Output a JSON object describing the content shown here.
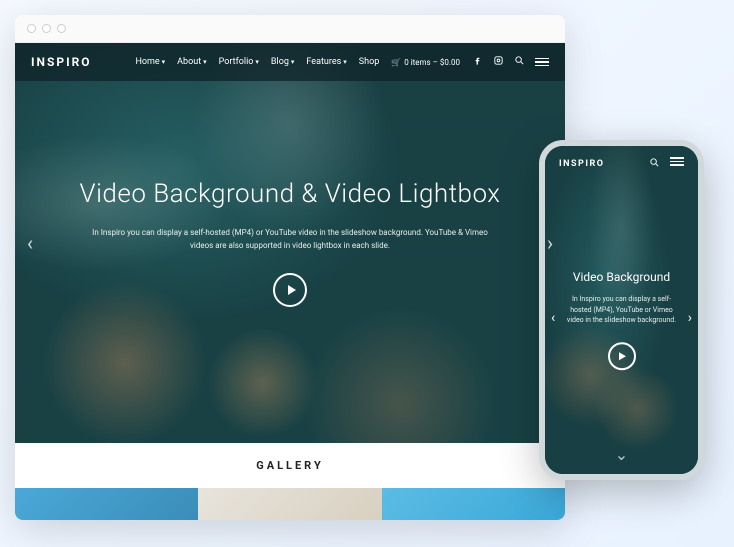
{
  "desktop": {
    "logo": "INSPIRO",
    "nav": {
      "home": "Home",
      "about": "About",
      "portfolio": "Portfolio",
      "blog": "Blog",
      "features": "Features",
      "shop": "Shop",
      "cart": "0 items – $0.00"
    },
    "hero": {
      "title": "Video Background & Video Lightbox",
      "subtitle": "In Inspiro you can display a self-hosted (MP4) or YouTube video in the slideshow background. YouTube & Vimeo videos are also supported in video lightbox in each slide."
    },
    "gallery_label": "GALLERY"
  },
  "mobile": {
    "logo": "INSPIRO",
    "hero": {
      "title": "Video Background",
      "subtitle": "In Inspiro you can display a self-hosted (MP4), YouTube or Vimeo video in the slideshow background."
    }
  }
}
